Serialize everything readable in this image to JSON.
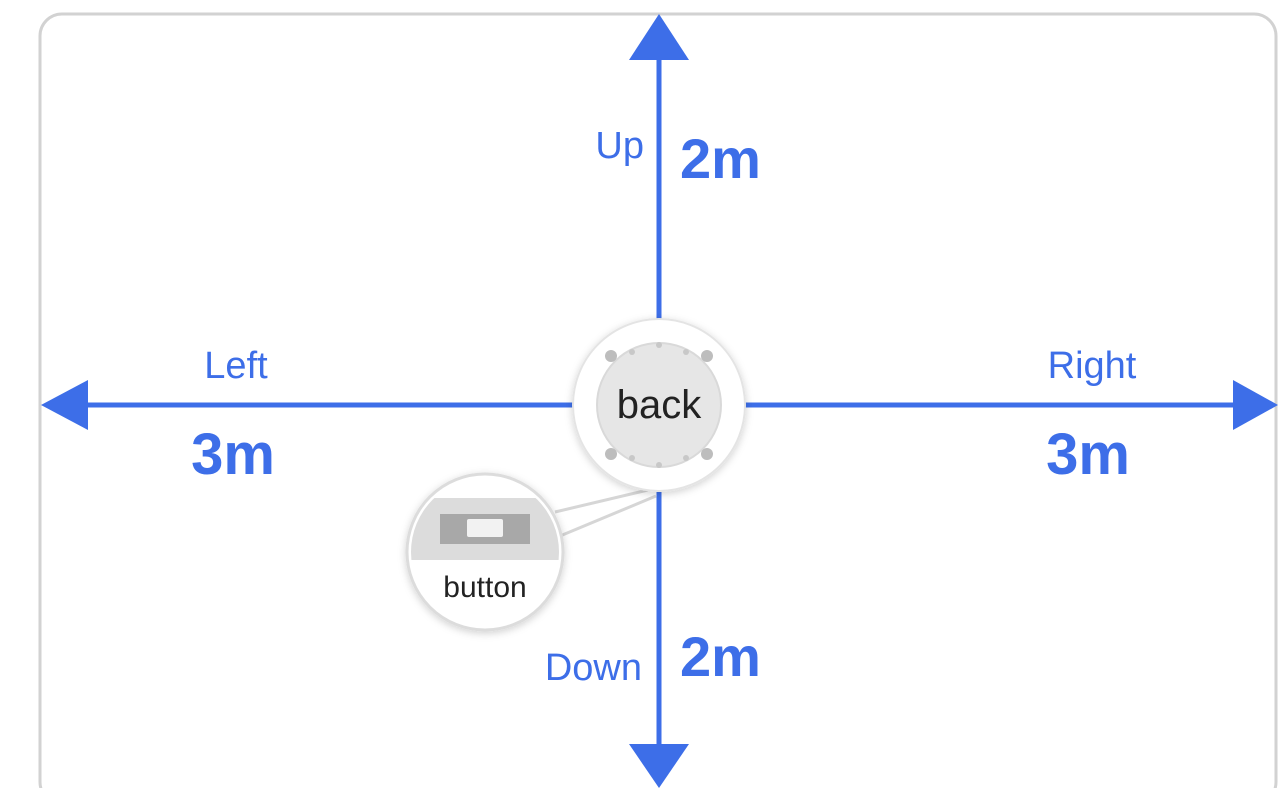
{
  "diagram": {
    "center_label": "back",
    "callout_label": "button",
    "directions": {
      "up": {
        "label": "Up",
        "distance": "2m"
      },
      "down": {
        "label": "Down",
        "distance": "2m"
      },
      "left": {
        "label": "Left",
        "distance": "3m"
      },
      "right": {
        "label": "Right",
        "distance": "3m"
      }
    },
    "colors": {
      "accent": "#3d6ee8",
      "frame": "#d2d2d2",
      "device_fill": "#e6e6e6",
      "device_ring": "#dcdcdc",
      "text_dark": "#222222"
    }
  }
}
